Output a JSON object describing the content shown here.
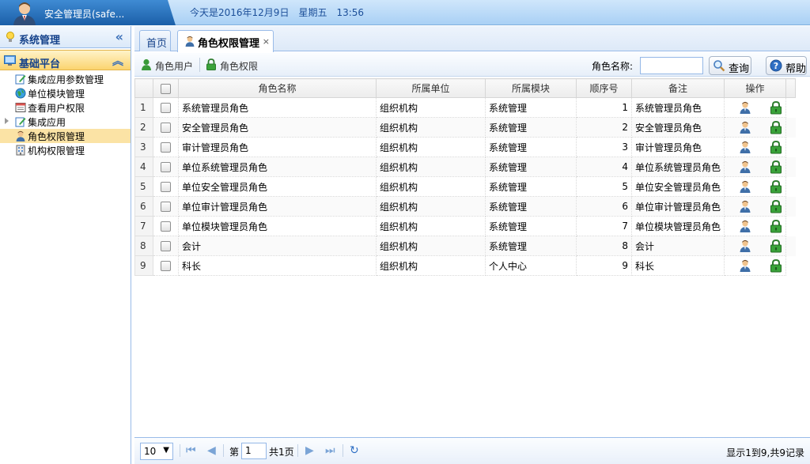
{
  "header": {
    "user_name": "安全管理员(safe...",
    "date_text": "今天是2016年12月9日　星期五　13:56"
  },
  "sidebar": {
    "title": "系统管理",
    "group": "基础平台",
    "items": [
      {
        "label": "集成应用参数管理",
        "icon": "edit-icon"
      },
      {
        "label": "单位模块管理",
        "icon": "globe-icon"
      },
      {
        "label": "查看用户权限",
        "icon": "calendar-icon"
      },
      {
        "label": "集成应用",
        "icon": "edit-icon"
      },
      {
        "label": "角色权限管理",
        "icon": "user-icon"
      },
      {
        "label": "机构权限管理",
        "icon": "building-icon"
      }
    ]
  },
  "tabs": [
    {
      "label": "首页"
    },
    {
      "label": "角色权限管理",
      "close": "×"
    }
  ],
  "toolbar": {
    "role_user_label": "角色用户",
    "role_perm_label": "角色权限",
    "search_label": "角色名称:",
    "search_value": "",
    "query_label": "查询",
    "help_label": "帮助"
  },
  "grid": {
    "columns": [
      "角色名称",
      "所属单位",
      "所属模块",
      "顺序号",
      "备注",
      "操作"
    ],
    "rows": [
      {
        "no": "1",
        "name": "系统管理员角色",
        "unit": "组织机构",
        "module": "系统管理",
        "order": "1",
        "remark": "系统管理员角色"
      },
      {
        "no": "2",
        "name": "安全管理员角色",
        "unit": "组织机构",
        "module": "系统管理",
        "order": "2",
        "remark": "安全管理员角色"
      },
      {
        "no": "3",
        "name": "审计管理员角色",
        "unit": "组织机构",
        "module": "系统管理",
        "order": "3",
        "remark": "审计管理员角色"
      },
      {
        "no": "4",
        "name": "单位系统管理员角色",
        "unit": "组织机构",
        "module": "系统管理",
        "order": "4",
        "remark": "单位系统管理员角色"
      },
      {
        "no": "5",
        "name": "单位安全管理员角色",
        "unit": "组织机构",
        "module": "系统管理",
        "order": "5",
        "remark": "单位安全管理员角色"
      },
      {
        "no": "6",
        "name": "单位审计管理员角色",
        "unit": "组织机构",
        "module": "系统管理",
        "order": "6",
        "remark": "单位审计管理员角色"
      },
      {
        "no": "7",
        "name": "单位模块管理员角色",
        "unit": "组织机构",
        "module": "系统管理",
        "order": "7",
        "remark": "单位模块管理员角色"
      },
      {
        "no": "8",
        "name": "会计",
        "unit": "组织机构",
        "module": "系统管理",
        "order": "8",
        "remark": "会计"
      },
      {
        "no": "9",
        "name": "科长",
        "unit": "组织机构",
        "module": "个人中心",
        "order": "9",
        "remark": "科长"
      }
    ]
  },
  "pager": {
    "page_size": "10",
    "page_prefix": "第",
    "current_page": "1",
    "page_suffix": "共1页",
    "info": "显示1到9,共9记录"
  }
}
